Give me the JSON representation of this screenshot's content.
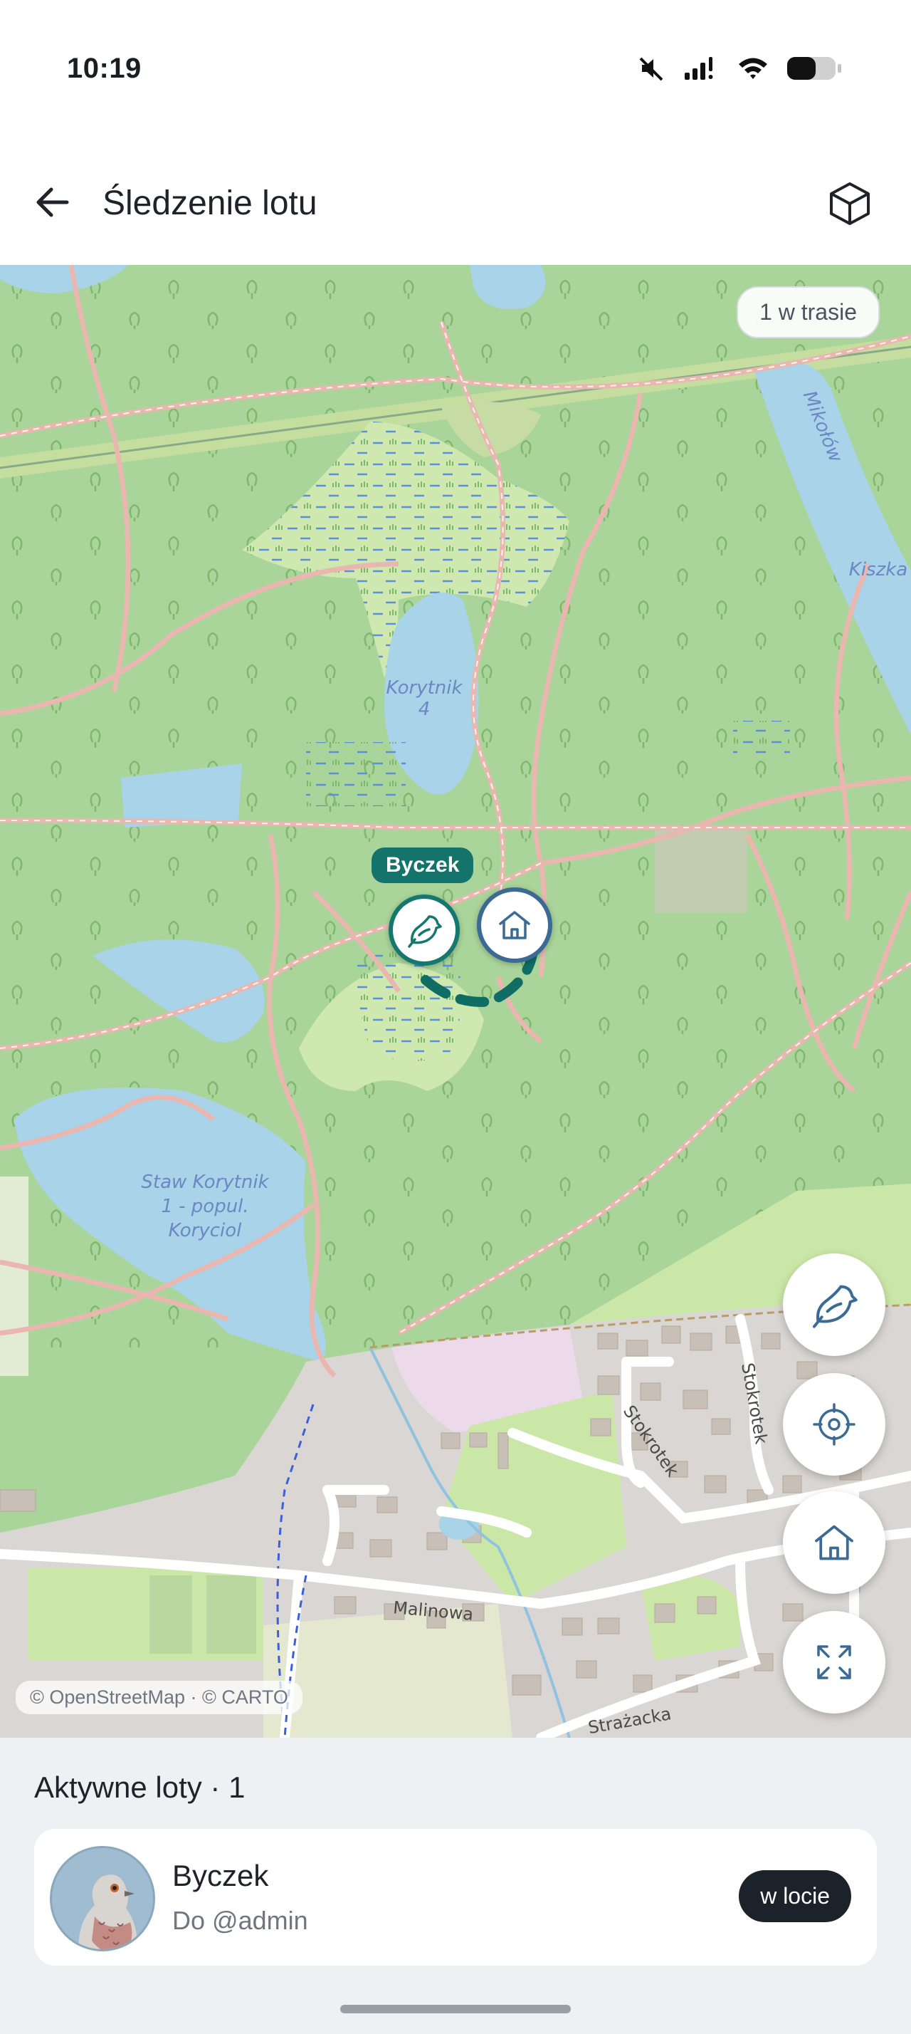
{
  "status_bar": {
    "time": "10:19"
  },
  "app_bar": {
    "title": "Śledzenie lotu"
  },
  "map": {
    "route_badge": "1 w trasie",
    "attribution": "© OpenStreetMap · © CARTO",
    "labels": {
      "river": "Mikołów",
      "river2": "Kiszka",
      "lake1_line1": "Korytnik",
      "lake1_line2": "4",
      "lake2_line1": "Staw Korytnik",
      "lake2_line2": "1 - popul.",
      "lake2_line3": "Koryciol",
      "street1": "Stokrotek",
      "street2": "Stokrotek",
      "street3": "Malinowa",
      "street4": "Strażacka"
    },
    "bird_label": "Byczek"
  },
  "sheet": {
    "title": "Aktywne loty · 1",
    "flights": [
      {
        "name": "Byczek",
        "destination": "Do @admin",
        "status": "w locie"
      }
    ]
  },
  "colors": {
    "accent": "#15786f",
    "home": "#3b6a95",
    "pill": "#1b2229"
  },
  "icons": {
    "back": "arrow-left-icon",
    "cube": "cube-icon",
    "bird": "bird-icon",
    "home": "home-icon",
    "target": "crosshair-icon",
    "expand": "expand-icon"
  }
}
